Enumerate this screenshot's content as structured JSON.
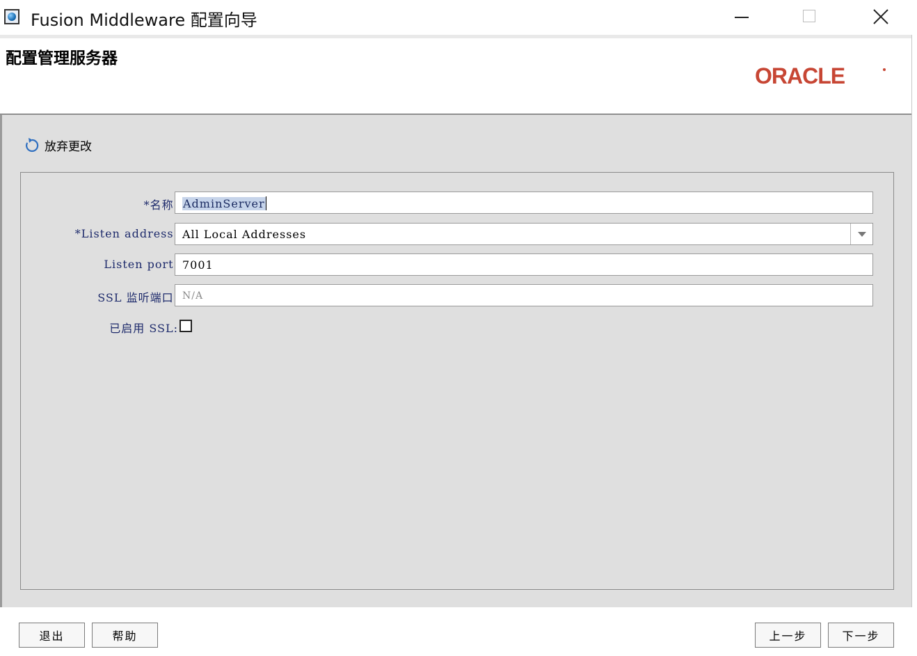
{
  "window": {
    "title": "Fusion Middleware 配置向导",
    "app_icon": "globe-app-icon",
    "controls": [
      "minimize-icon",
      "maximize-icon",
      "close-icon"
    ]
  },
  "header": {
    "page_title": "配置管理服务器",
    "logo_text": "ORACLE"
  },
  "toolbar": {
    "discard_label": "放弃更改",
    "discard_icon": "refresh-icon"
  },
  "form": {
    "name_label": "*名称:",
    "name_value": "AdminServer",
    "listen_address_label": "*Listen address:",
    "listen_address_value": "All Local Addresses",
    "listen_port_label": "Listen port:",
    "listen_port_value": "7001",
    "ssl_port_label": "SSL 监听端口:",
    "ssl_port_value": "N/A",
    "ssl_enabled_label": "已启用 SSL:",
    "ssl_enabled": false
  },
  "buttons": {
    "exit": "退出",
    "help": "帮助",
    "back": "上一步",
    "next": "下一步"
  },
  "colors": {
    "oracle_red": "#c74634",
    "label_blue": "#1d2a6b",
    "panel_gray": "#dfdfdf"
  }
}
